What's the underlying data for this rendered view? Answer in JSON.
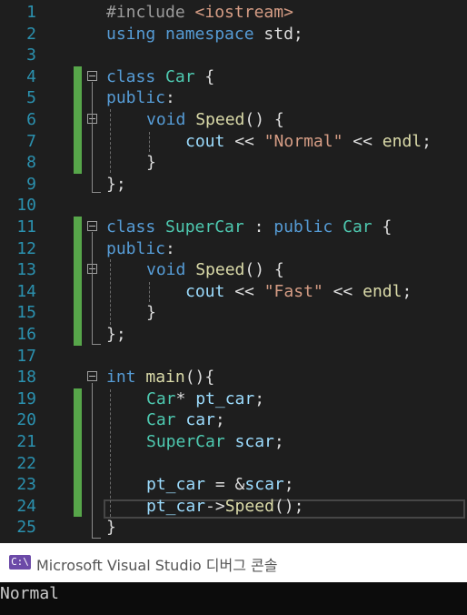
{
  "editor": {
    "line_numbers": [
      "1",
      "2",
      "3",
      "4",
      "5",
      "6",
      "7",
      "8",
      "9",
      "10",
      "11",
      "12",
      "13",
      "14",
      "15",
      "16",
      "17",
      "18",
      "19",
      "20",
      "21",
      "22",
      "23",
      "24",
      "25"
    ],
    "tokens": {
      "l1": {
        "pp": "#include ",
        "inc": "<iostream>"
      },
      "l2": {
        "kw1": "using",
        "kw2": "namespace",
        "pl": " std;"
      },
      "l4": {
        "kw": "class",
        "ty": "Car",
        "pl": " {"
      },
      "l5": {
        "kw": "public",
        "pl": ":"
      },
      "l6": {
        "kw": "void",
        "fn": "Speed",
        "pl": "() {"
      },
      "l7": {
        "var": "cout",
        "op1": " << ",
        "str": "\"Normal\"",
        "op2": " << ",
        "fn": "endl",
        "pl": ";"
      },
      "l8": {
        "pl": "}"
      },
      "l9": {
        "pl": "};"
      },
      "l11": {
        "kw1": "class",
        "ty1": "SuperCar",
        "pl1": " : ",
        "kw2": "public",
        "ty2": "Car",
        "pl2": " {"
      },
      "l12": {
        "kw": "public",
        "pl": ":"
      },
      "l13": {
        "kw": "void",
        "fn": "Speed",
        "pl": "() {"
      },
      "l14": {
        "var": "cout",
        "op1": " << ",
        "str": "\"Fast\"",
        "op2": " << ",
        "fn": "endl",
        "pl": ";"
      },
      "l15": {
        "pl": "}"
      },
      "l16": {
        "pl": "};"
      },
      "l18": {
        "kw": "int",
        "fn": "main",
        "pl": "(){"
      },
      "l19": {
        "ty": "Car",
        "pl": "* ",
        "var": "pt_car",
        "pl2": ";"
      },
      "l20": {
        "ty": "Car",
        "var": "car",
        "pl": ";"
      },
      "l21": {
        "ty": "SuperCar",
        "var": "scar",
        "pl": ";"
      },
      "l23": {
        "var": "pt_car",
        "pl": " = &",
        "var2": "scar",
        "pl2": ";"
      },
      "l24": {
        "var": "pt_car",
        "op": "->",
        "fn": "Speed",
        "pl": "();"
      },
      "l25": {
        "pl": "}"
      }
    }
  },
  "console": {
    "icon_text": "C:\\",
    "title": "Microsoft Visual Studio 디버그 콘솔",
    "output": "Normal"
  },
  "colors": {
    "background": "#1e1e1e",
    "line_number": "#2b91af",
    "keyword": "#569cd6",
    "type": "#4ec9b0",
    "function": "#dcdcaa",
    "string": "#d69d85",
    "variable": "#9cdcfe",
    "change_gutter": "#57a64a"
  }
}
